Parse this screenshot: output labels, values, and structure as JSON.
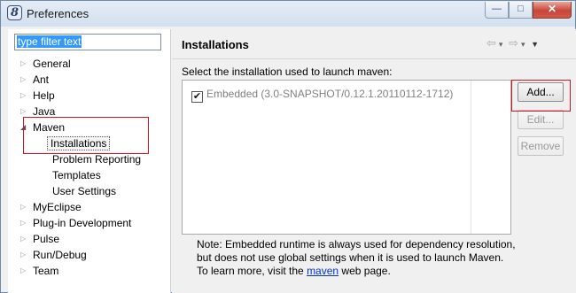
{
  "window": {
    "title": "Preferences",
    "app_icon": "eclipse-8-icon",
    "controls": {
      "minimize": "—",
      "maximize": "□",
      "close": "✕"
    }
  },
  "filter": {
    "value": "type filter text"
  },
  "tree": {
    "items": [
      {
        "label": "General",
        "level": 0,
        "expandable": true,
        "expanded": false
      },
      {
        "label": "Ant",
        "level": 0,
        "expandable": true,
        "expanded": false
      },
      {
        "label": "Help",
        "level": 0,
        "expandable": true,
        "expanded": false
      },
      {
        "label": "Java",
        "level": 0,
        "expandable": true,
        "expanded": false
      },
      {
        "label": "Maven",
        "level": 0,
        "expandable": true,
        "expanded": true
      },
      {
        "label": "Installations",
        "level": 1,
        "selected": true
      },
      {
        "label": "Problem Reporting",
        "level": 1
      },
      {
        "label": "Templates",
        "level": 1
      },
      {
        "label": "User Settings",
        "level": 1
      },
      {
        "label": "MyEclipse",
        "level": 0,
        "expandable": true,
        "expanded": false
      },
      {
        "label": "Plug-in Development",
        "level": 0,
        "expandable": true,
        "expanded": false
      },
      {
        "label": "Pulse",
        "level": 0,
        "expandable": true,
        "expanded": false
      },
      {
        "label": "Run/Debug",
        "level": 0,
        "expandable": true,
        "expanded": false
      },
      {
        "label": "Team",
        "level": 0,
        "expandable": true,
        "expanded": false
      }
    ]
  },
  "page": {
    "title": "Installations",
    "select_label": "Select the installation used to launch maven:",
    "installations": [
      {
        "checked": true,
        "label": "Embedded (3.0-SNAPSHOT/0.12.1.20110112-1712)"
      }
    ],
    "buttons": {
      "add": "Add...",
      "edit": "Edit...",
      "remove": "Remove"
    },
    "note": {
      "line1": "Note: Embedded runtime is always used for dependency resolution,",
      "line2": "but does not use global settings when it is used to launch Maven.",
      "line3_prefix": "To learn more, visit the ",
      "line3_link": "maven",
      "line3_suffix": " web page."
    }
  },
  "colors": {
    "highlight_box": "#d0161c",
    "link": "#0033cc",
    "selection": "#3399ff"
  }
}
